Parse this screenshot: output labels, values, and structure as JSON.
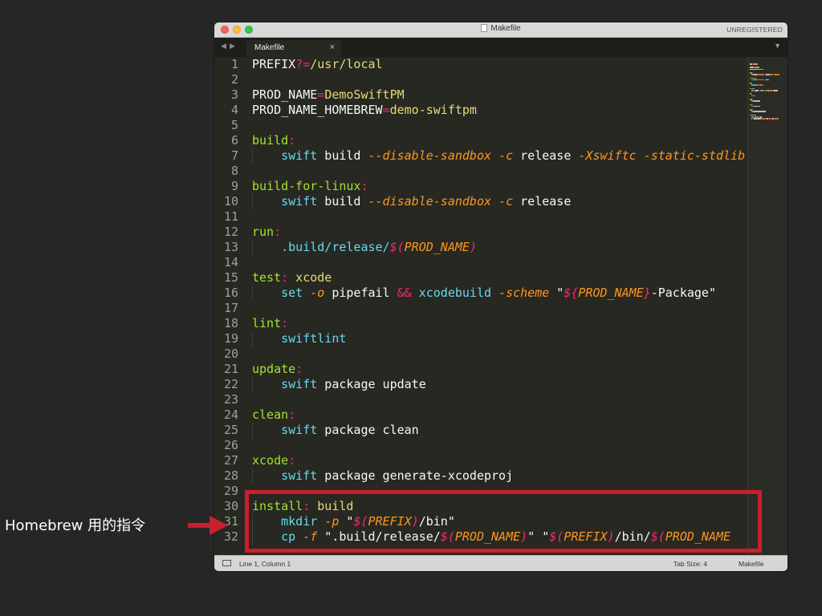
{
  "window": {
    "title": "Makefile",
    "status_badge": "UNREGISTERED",
    "tab_label": "Makefile",
    "tab_close": "×",
    "nav_back": "◀",
    "nav_forward": "▶",
    "dropdown": "▼"
  },
  "colors": {
    "plain": "#f8f8f2",
    "pink": "#f92672",
    "yellow": "#e6db74",
    "green": "#a6e22e",
    "cyan": "#66d9ef",
    "orange": "#fd971f",
    "purple": "#ae81ff"
  },
  "code": [
    {
      "n": "1",
      "indent": false,
      "tokens": [
        {
          "t": "PREFIX",
          "c": "plain"
        },
        {
          "t": "?=",
          "c": "pink"
        },
        {
          "t": "/usr/local",
          "c": "yellow"
        }
      ]
    },
    {
      "n": "2",
      "indent": false,
      "tokens": []
    },
    {
      "n": "3",
      "indent": false,
      "tokens": [
        {
          "t": "PROD_NAME",
          "c": "plain"
        },
        {
          "t": "=",
          "c": "pink"
        },
        {
          "t": "DemoSwiftPM",
          "c": "yellow"
        }
      ]
    },
    {
      "n": "4",
      "indent": false,
      "tokens": [
        {
          "t": "PROD_NAME_HOMEBREW",
          "c": "plain"
        },
        {
          "t": "=",
          "c": "pink"
        },
        {
          "t": "demo-swiftpm",
          "c": "yellow"
        }
      ]
    },
    {
      "n": "5",
      "indent": false,
      "tokens": []
    },
    {
      "n": "6",
      "indent": false,
      "tokens": [
        {
          "t": "build",
          "c": "green"
        },
        {
          "t": ":",
          "c": "pink"
        }
      ]
    },
    {
      "n": "7",
      "indent": true,
      "tokens": [
        {
          "t": "    ",
          "c": "plain"
        },
        {
          "t": "swift",
          "c": "cyan"
        },
        {
          "t": " build ",
          "c": "plain"
        },
        {
          "t": "--disable-sandbox",
          "c": "orange",
          "i": true
        },
        {
          "t": " ",
          "c": "plain"
        },
        {
          "t": "-c",
          "c": "orange",
          "i": true
        },
        {
          "t": " release ",
          "c": "plain"
        },
        {
          "t": "-Xswiftc",
          "c": "orange",
          "i": true
        },
        {
          "t": " ",
          "c": "plain"
        },
        {
          "t": "-static-stdlib",
          "c": "orange",
          "i": true
        }
      ]
    },
    {
      "n": "8",
      "indent": false,
      "tokens": []
    },
    {
      "n": "9",
      "indent": false,
      "tokens": [
        {
          "t": "build-for-linux",
          "c": "green"
        },
        {
          "t": ":",
          "c": "pink"
        }
      ]
    },
    {
      "n": "10",
      "indent": true,
      "tokens": [
        {
          "t": "    ",
          "c": "plain"
        },
        {
          "t": "swift",
          "c": "cyan"
        },
        {
          "t": " build ",
          "c": "plain"
        },
        {
          "t": "--disable-sandbox",
          "c": "orange",
          "i": true
        },
        {
          "t": " ",
          "c": "plain"
        },
        {
          "t": "-c",
          "c": "orange",
          "i": true
        },
        {
          "t": " release",
          "c": "plain"
        }
      ]
    },
    {
      "n": "11",
      "indent": false,
      "tokens": []
    },
    {
      "n": "12",
      "indent": false,
      "tokens": [
        {
          "t": "run",
          "c": "green"
        },
        {
          "t": ":",
          "c": "pink"
        }
      ]
    },
    {
      "n": "13",
      "indent": true,
      "tokens": [
        {
          "t": "    ",
          "c": "plain"
        },
        {
          "t": ".build/release/",
          "c": "cyan"
        },
        {
          "t": "$(",
          "c": "pink",
          "i": true
        },
        {
          "t": "PROD_NAME",
          "c": "orange",
          "i": true
        },
        {
          "t": ")",
          "c": "pink",
          "i": true
        }
      ]
    },
    {
      "n": "14",
      "indent": false,
      "tokens": []
    },
    {
      "n": "15",
      "indent": false,
      "tokens": [
        {
          "t": "test",
          "c": "green"
        },
        {
          "t": ":",
          "c": "pink"
        },
        {
          "t": " xcode",
          "c": "yellow"
        }
      ]
    },
    {
      "n": "16",
      "indent": true,
      "tokens": [
        {
          "t": "    ",
          "c": "plain"
        },
        {
          "t": "set",
          "c": "cyan"
        },
        {
          "t": " ",
          "c": "plain"
        },
        {
          "t": "-o",
          "c": "orange",
          "i": true
        },
        {
          "t": " pipefail ",
          "c": "plain"
        },
        {
          "t": "&&",
          "c": "pink"
        },
        {
          "t": " ",
          "c": "plain"
        },
        {
          "t": "xcodebuild",
          "c": "cyan"
        },
        {
          "t": " ",
          "c": "plain"
        },
        {
          "t": "-scheme",
          "c": "orange",
          "i": true
        },
        {
          "t": " \"",
          "c": "plain"
        },
        {
          "t": "${",
          "c": "pink",
          "i": true
        },
        {
          "t": "PROD_NAME",
          "c": "orange",
          "i": true
        },
        {
          "t": "}",
          "c": "pink",
          "i": true
        },
        {
          "t": "-Package\"",
          "c": "plain"
        }
      ]
    },
    {
      "n": "17",
      "indent": false,
      "tokens": []
    },
    {
      "n": "18",
      "indent": false,
      "tokens": [
        {
          "t": "lint",
          "c": "green"
        },
        {
          "t": ":",
          "c": "pink"
        }
      ]
    },
    {
      "n": "19",
      "indent": true,
      "tokens": [
        {
          "t": "    ",
          "c": "plain"
        },
        {
          "t": "swiftlint",
          "c": "cyan"
        }
      ]
    },
    {
      "n": "20",
      "indent": false,
      "tokens": []
    },
    {
      "n": "21",
      "indent": false,
      "tokens": [
        {
          "t": "update",
          "c": "green"
        },
        {
          "t": ":",
          "c": "pink"
        }
      ]
    },
    {
      "n": "22",
      "indent": true,
      "tokens": [
        {
          "t": "    ",
          "c": "plain"
        },
        {
          "t": "swift",
          "c": "cyan"
        },
        {
          "t": " package update",
          "c": "plain"
        }
      ]
    },
    {
      "n": "23",
      "indent": false,
      "tokens": []
    },
    {
      "n": "24",
      "indent": false,
      "tokens": [
        {
          "t": "clean",
          "c": "green"
        },
        {
          "t": ":",
          "c": "pink"
        }
      ]
    },
    {
      "n": "25",
      "indent": true,
      "tokens": [
        {
          "t": "    ",
          "c": "plain"
        },
        {
          "t": "swift",
          "c": "cyan"
        },
        {
          "t": " package clean",
          "c": "plain"
        }
      ]
    },
    {
      "n": "26",
      "indent": false,
      "tokens": []
    },
    {
      "n": "27",
      "indent": false,
      "tokens": [
        {
          "t": "xcode",
          "c": "green"
        },
        {
          "t": ":",
          "c": "pink"
        }
      ]
    },
    {
      "n": "28",
      "indent": true,
      "tokens": [
        {
          "t": "    ",
          "c": "plain"
        },
        {
          "t": "swift",
          "c": "cyan"
        },
        {
          "t": " package generate-xcodeproj",
          "c": "plain"
        }
      ]
    },
    {
      "n": "29",
      "indent": false,
      "tokens": []
    },
    {
      "n": "30",
      "indent": false,
      "tokens": [
        {
          "t": "install",
          "c": "green"
        },
        {
          "t": ":",
          "c": "pink"
        },
        {
          "t": " build",
          "c": "yellow"
        }
      ]
    },
    {
      "n": "31",
      "indent": true,
      "tokens": [
        {
          "t": "    ",
          "c": "plain"
        },
        {
          "t": "mkdir",
          "c": "cyan"
        },
        {
          "t": " ",
          "c": "plain"
        },
        {
          "t": "-p",
          "c": "orange",
          "i": true
        },
        {
          "t": " \"",
          "c": "plain"
        },
        {
          "t": "$(",
          "c": "pink",
          "i": true
        },
        {
          "t": "PREFIX",
          "c": "orange",
          "i": true
        },
        {
          "t": ")",
          "c": "pink",
          "i": true
        },
        {
          "t": "/bin\"",
          "c": "plain"
        }
      ]
    },
    {
      "n": "32",
      "indent": true,
      "tokens": [
        {
          "t": "    ",
          "c": "plain"
        },
        {
          "t": "cp",
          "c": "cyan"
        },
        {
          "t": " ",
          "c": "plain"
        },
        {
          "t": "-f",
          "c": "orange",
          "i": true
        },
        {
          "t": " \".build/release/",
          "c": "plain"
        },
        {
          "t": "$(",
          "c": "pink",
          "i": true
        },
        {
          "t": "PROD_NAME",
          "c": "orange",
          "i": true
        },
        {
          "t": ")",
          "c": "pink",
          "i": true
        },
        {
          "t": "\" \"",
          "c": "plain"
        },
        {
          "t": "$(",
          "c": "pink",
          "i": true
        },
        {
          "t": "PREFIX",
          "c": "orange",
          "i": true
        },
        {
          "t": ")",
          "c": "pink",
          "i": true
        },
        {
          "t": "/bin/",
          "c": "plain"
        },
        {
          "t": "$(",
          "c": "pink",
          "i": true
        },
        {
          "t": "PROD_NAME",
          "c": "orange",
          "i": true
        }
      ]
    }
  ],
  "status": {
    "position": "Line 1, Column 1",
    "tab_size": "Tab Size: 4",
    "syntax": "Makefile"
  },
  "annotation": {
    "text": "Homebrew 用的指令"
  }
}
